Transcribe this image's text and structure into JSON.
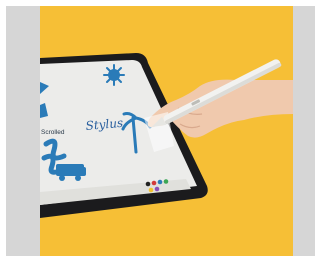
{
  "image": {
    "kind": "product-photo",
    "subject": "tablet-with-stylus",
    "colors": {
      "page_background": "#ffffff",
      "side_border": "#d6d6d6",
      "backdrop": "#f6bf36",
      "tablet_body": "#1b1b1d",
      "screen": "#ececea",
      "ink_blue": "#2a7bb8",
      "stylus": "#f2f2f0",
      "skin": "#f0c9ad"
    }
  },
  "screen_text": {
    "word_stylus": "Stylus",
    "word_small": "Scrolled"
  }
}
